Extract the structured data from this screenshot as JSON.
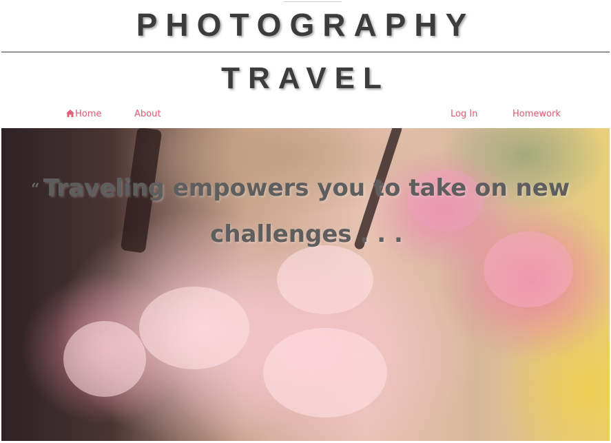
{
  "header": {
    "title": "PHOTOGRAPHY",
    "subtitle": "TRAVEL"
  },
  "nav": {
    "home": {
      "label": "Home",
      "icon": "home-icon"
    },
    "about": {
      "label": "About"
    },
    "login": {
      "label": "Log In"
    },
    "homework": {
      "label": "Homework"
    },
    "link_color": "#e0627a"
  },
  "hero": {
    "quote_icon": "quote-icon",
    "quote": "Traveling empowers you to take on new challenges . . .",
    "image": "cherry-blossom-photo"
  },
  "colors": {
    "title_text": "#3c3c3c",
    "quote_text": "#5e5e5e"
  }
}
